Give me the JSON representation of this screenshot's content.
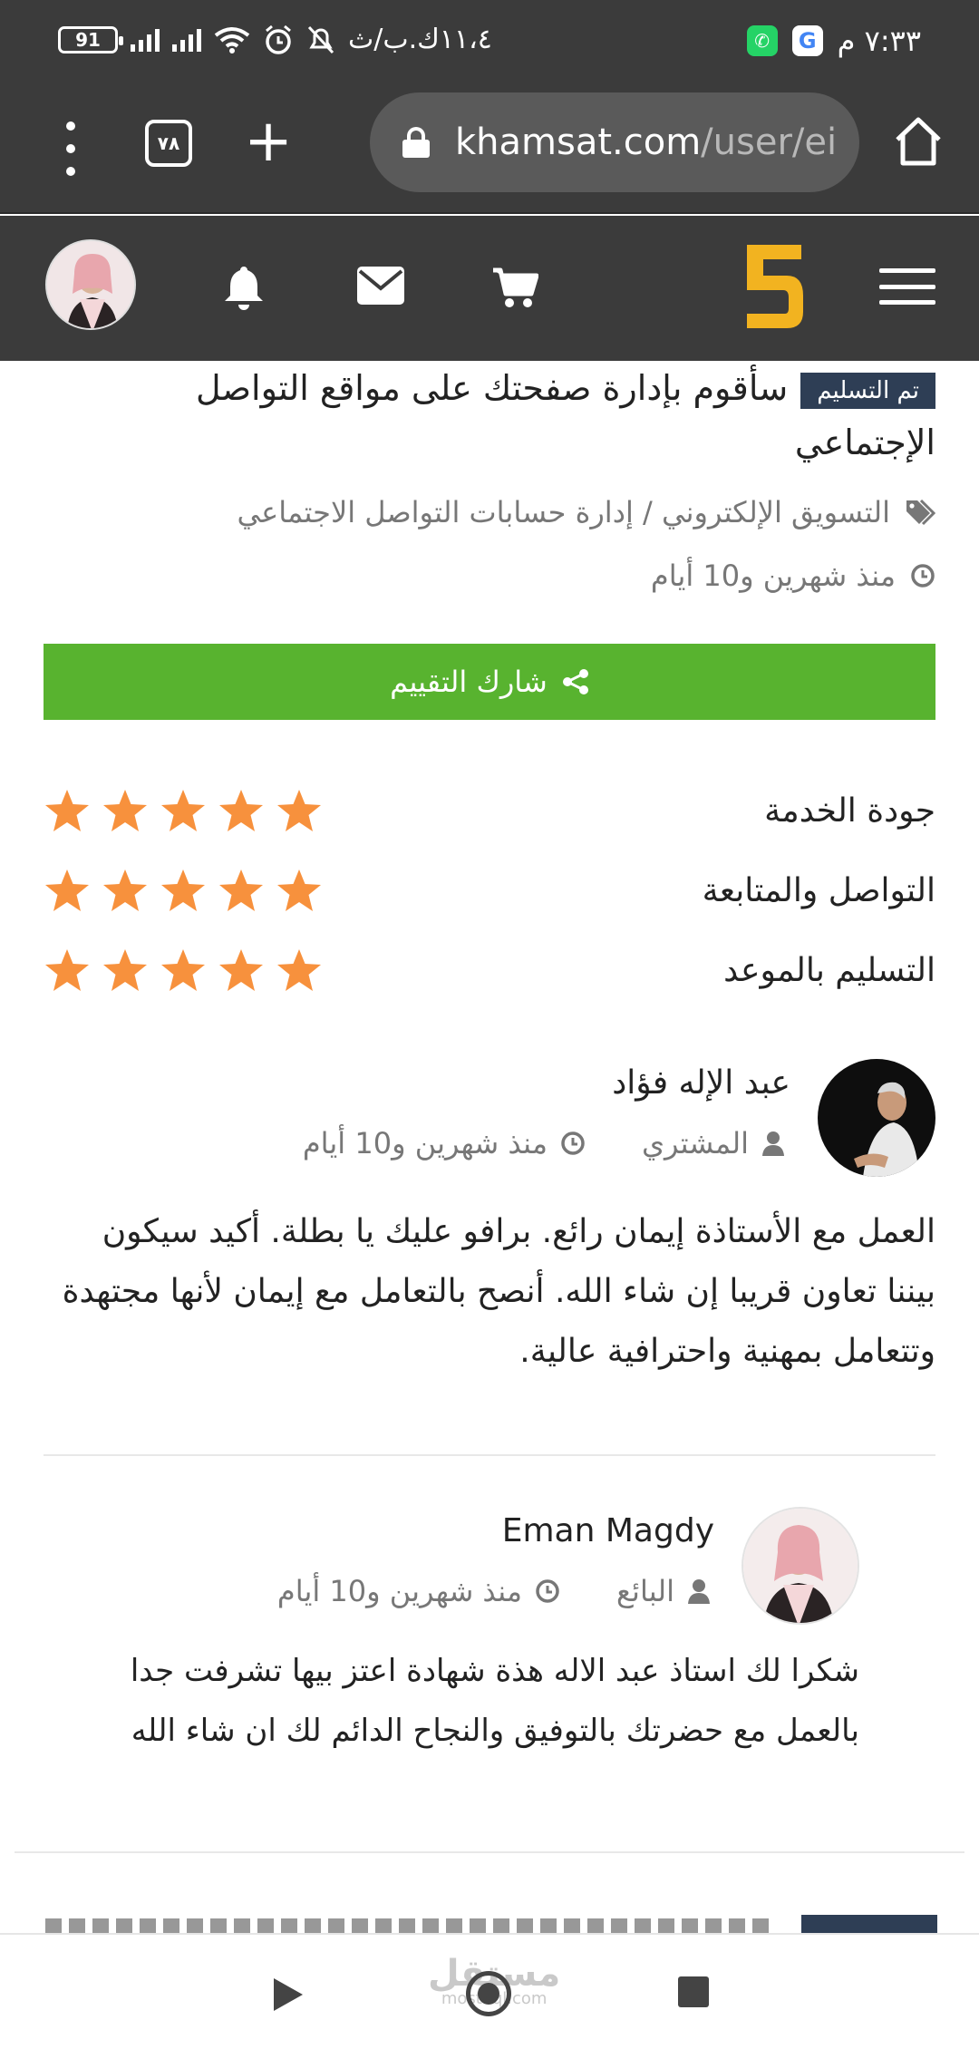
{
  "status_bar": {
    "time": "٧:٣٣ م",
    "speed": "١١،٤ك.ب/ث",
    "battery": "91",
    "apps": [
      "whatsapp-icon",
      "google-icon"
    ]
  },
  "browser": {
    "tab_count": "٧٨",
    "url_host": "khamsat.com",
    "url_path": "/user/ei"
  },
  "header": {
    "logo_color": "#f2b320",
    "icons": [
      "bell-icon",
      "envelope-icon",
      "cart-icon"
    ]
  },
  "service": {
    "status_badge": "تم التسليم",
    "title": "سأقوم بإدارة صفحتك على مواقع التواصل الإجتماعي",
    "category": "التسويق الإلكتروني / إدارة حسابات التواصل الاجتماعي",
    "time_ago": "منذ شهرين و10 أيام"
  },
  "share_button": {
    "label": "شارك التقييم",
    "color": "#58b32f"
  },
  "ratings": [
    {
      "label": "جودة الخدمة",
      "stars": 5
    },
    {
      "label": "التواصل والمتابعة",
      "stars": 5
    },
    {
      "label": "التسليم بالموعد",
      "stars": 5
    }
  ],
  "star_color": "#f7913d",
  "reviews": [
    {
      "name": "عبد الإله فؤاد",
      "role": "المشتري",
      "time_ago": "منذ شهرين و10 أيام",
      "text": "العمل مع الأستاذة إيمان رائع. برافو عليك يا بطلة. أكيد سيكون بيننا تعاون قريبا إن شاء الله. أنصح بالتعامل مع إيمان لأنها مجتهدة وتتعامل بمهنية واحترافية عالية."
    },
    {
      "name": "Eman Magdy",
      "role": "البائع",
      "time_ago": "منذ شهرين و10 أيام",
      "text": "شكرا لك استاذ عبد الاله هذة شهادة اعتز بيها تشرفت جدا بالعمل مع حضرتك بالتوفيق والنجاح الدائم لك ان شاء الله"
    }
  ],
  "watermark": {
    "arabic": "مستقل",
    "latin": "mostaql.com"
  }
}
